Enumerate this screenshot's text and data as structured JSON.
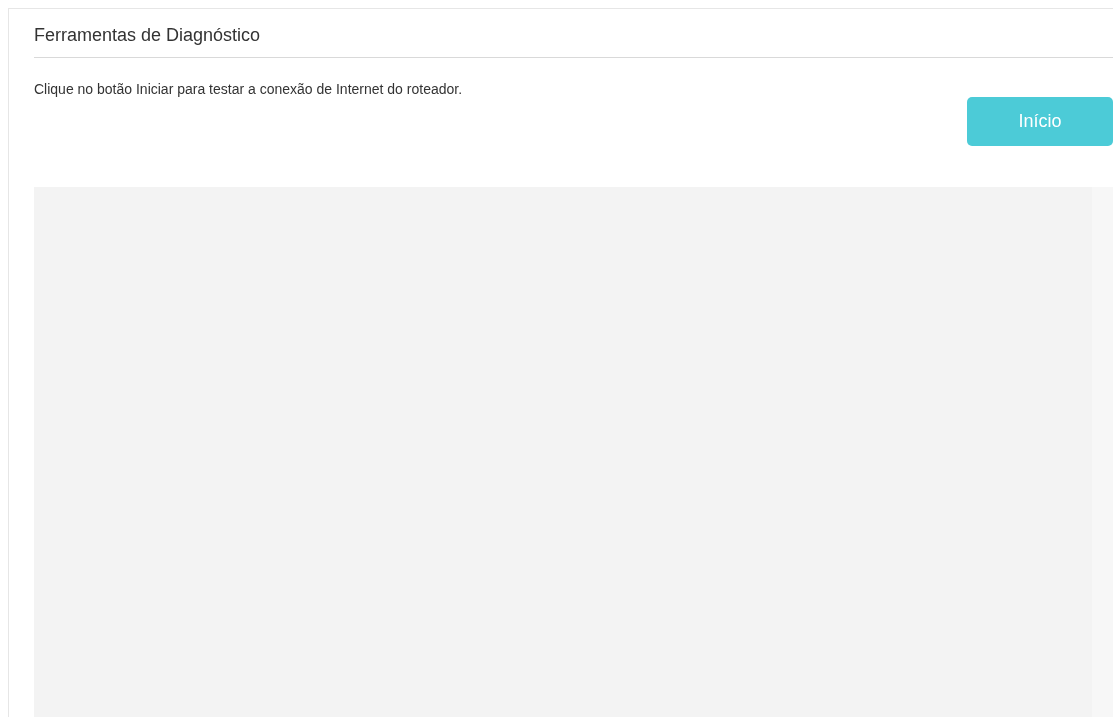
{
  "title": "Ferramentas de Diagnóstico",
  "instruction": "Clique no botão Iniciar para testar a conexão de Internet do roteador.",
  "start_button": {
    "label": "Início"
  },
  "output_panel": {
    "kind": "empty"
  }
}
